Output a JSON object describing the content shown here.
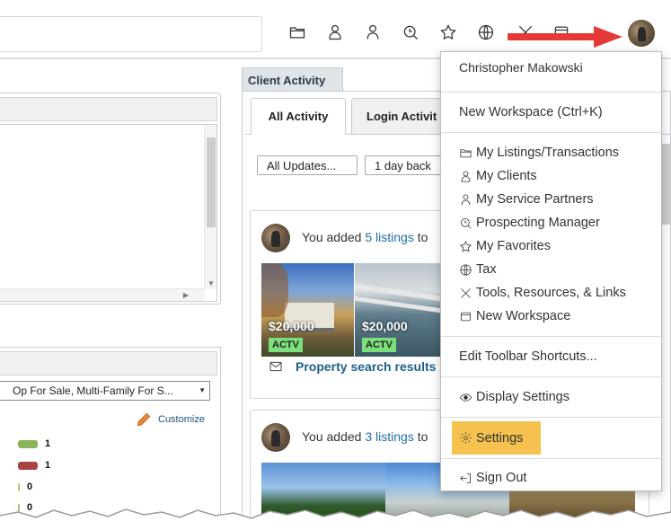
{
  "toolbar": {
    "icons": [
      "folder-icon",
      "clients-icon",
      "service-partners-icon",
      "prospecting-icon",
      "favorites-icon",
      "globe-icon",
      "tools-icon",
      "workspace-icon"
    ]
  },
  "client_activity": {
    "title": "Client Activity",
    "tabs": [
      {
        "label": "All Activity",
        "active": true
      },
      {
        "label": "Login Activit",
        "active": false
      }
    ],
    "filters": {
      "updates": "All Updates...",
      "period": "1 day back"
    },
    "cards": [
      {
        "text_prefix": "You added ",
        "link": "5 listings",
        "text_suffix": " to",
        "listings": [
          {
            "price": "$20,000",
            "status": "ACTV"
          },
          {
            "price": "$20,000",
            "status": "ACTV"
          }
        ],
        "footer": "Property search results"
      },
      {
        "text_prefix": "You added ",
        "link": "3 listings",
        "text_suffix": " to"
      }
    ]
  },
  "left_panel": {
    "property_select": "Op For Sale, Multi-Family For S...",
    "customize_label": "Customize",
    "counts": [
      {
        "value": "1",
        "color": "#8db35a"
      },
      {
        "value": "1",
        "color": "#a94442"
      },
      {
        "value": "0",
        "color": "#b6c27a"
      },
      {
        "value": "0",
        "color": "#b6c27a"
      }
    ]
  },
  "menu": {
    "user_name": "Christopher Makowski",
    "new_workspace_shortcut": "New Workspace (Ctrl+K)",
    "items": [
      {
        "label": "My Listings/Transactions",
        "icon": "folder-icon"
      },
      {
        "label": "My Clients",
        "icon": "clients-icon"
      },
      {
        "label": "My Service Partners",
        "icon": "service-partners-icon"
      },
      {
        "label": "Prospecting Manager",
        "icon": "prospecting-icon"
      },
      {
        "label": "My Favorites",
        "icon": "favorites-icon"
      },
      {
        "label": "Tax",
        "icon": "globe-icon"
      },
      {
        "label": "Tools, Resources, & Links",
        "icon": "tools-icon"
      },
      {
        "label": "New Workspace",
        "icon": "workspace-icon"
      }
    ],
    "edit_toolbar": "Edit Toolbar Shortcuts...",
    "display_settings": "Display Settings",
    "settings": "Settings",
    "sign_out": "Sign Out",
    "highlight_color": "#f5c14f"
  },
  "annotation": {
    "arrow_color": "#e53935"
  }
}
